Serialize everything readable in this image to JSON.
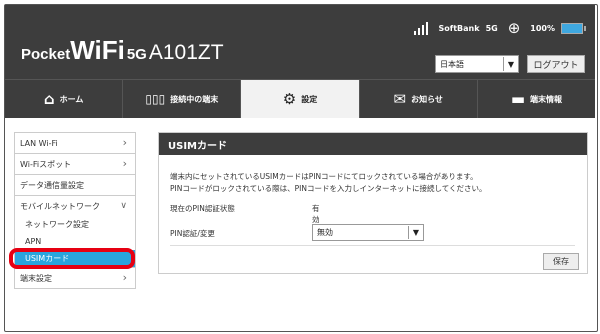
{
  "header": {
    "logo_pocket": "Pocket",
    "logo_wifi": "WiFi",
    "logo_5g": "5G",
    "model": "A101ZT",
    "carrier": "SoftBank",
    "network": "5G",
    "battery": "100%",
    "language": "日本語",
    "logout_label": "ログアウト"
  },
  "tabs": [
    {
      "label": "ホーム",
      "icon": "home-icon"
    },
    {
      "label": "接続中の端末",
      "icon": "devices-icon"
    },
    {
      "label": "設定",
      "icon": "gear-icon"
    },
    {
      "label": "お知らせ",
      "icon": "envelope-icon"
    },
    {
      "label": "端末情報",
      "icon": "device-info-icon"
    }
  ],
  "sidebar": {
    "items": [
      {
        "label": "LAN Wi-Fi"
      },
      {
        "label": "Wi-Fiスポット"
      },
      {
        "label": "データ通信量設定"
      },
      {
        "label": "モバイルネットワーク"
      },
      {
        "label": "ネットワーク設定"
      },
      {
        "label": "APN"
      },
      {
        "label": "USIMカード"
      },
      {
        "label": "端末設定"
      }
    ]
  },
  "panel": {
    "title": "USIMカード",
    "desc_line1": "端末内にセットされているUSIMカードはPINコードにてロックされている場合があります。",
    "desc_line2": "PINコードがロックされている際は、PINコードを入力しインターネットに接続してください。",
    "pin_status_label": "現在のPIN認証状態",
    "pin_status_value": "有効",
    "pin_change_label": "PIN認証/変更",
    "pin_change_value": "無効",
    "save_label": "保存"
  },
  "colors": {
    "header_bg": "#3d3d3d",
    "accent": "#2aa4dd",
    "highlight": "#e60012"
  }
}
